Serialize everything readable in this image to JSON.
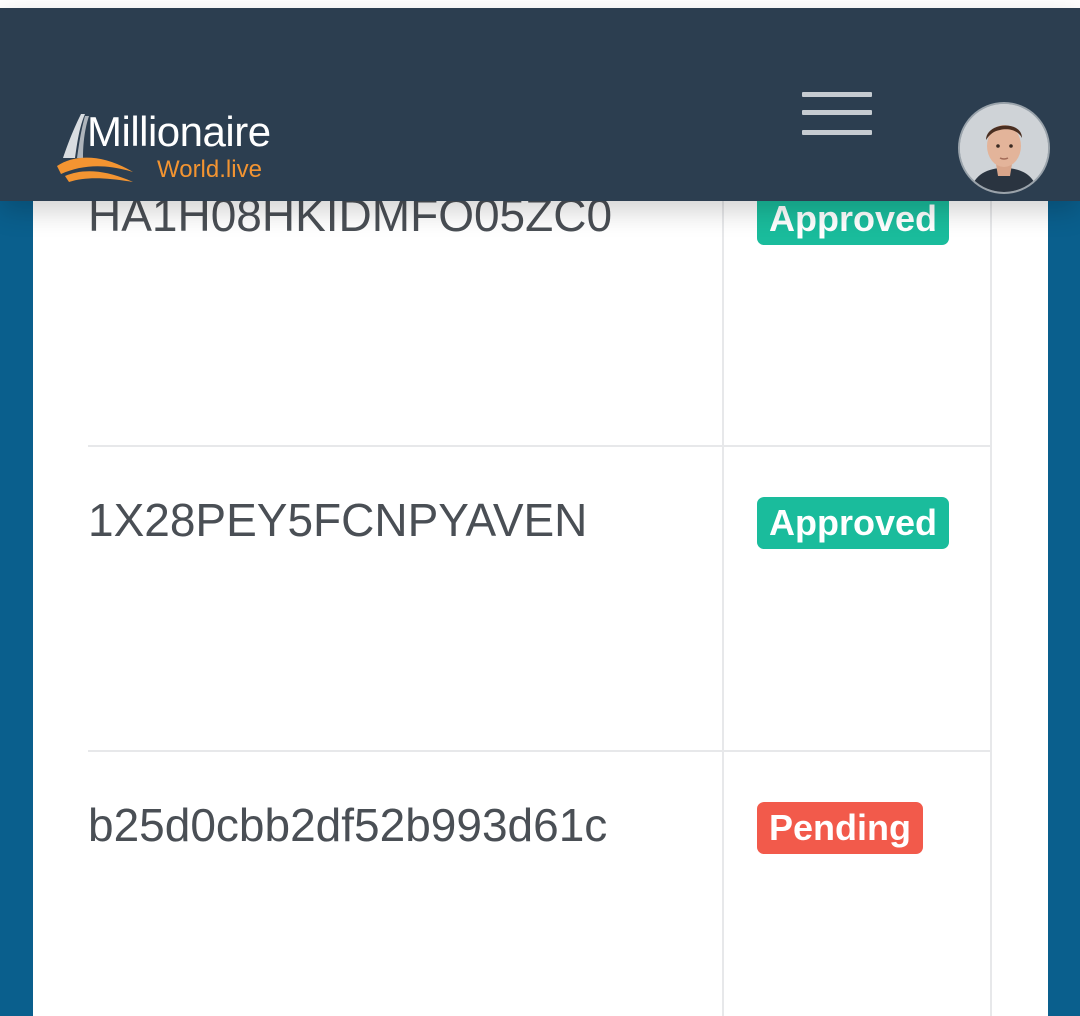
{
  "brand": {
    "name": "Millionaire",
    "subtitle": "World.live",
    "accent_color": "#f39431",
    "header_color": "#2c3e50"
  },
  "header": {
    "menu_icon": "hamburger-menu-icon",
    "avatar_icon": "user-avatar"
  },
  "transactions": [
    {
      "hash": "HA1H08HKIDMFO05ZC0",
      "status": "Approved",
      "status_color": "#1abc9c"
    },
    {
      "hash": "1X28PEY5FCNPYAVEN",
      "status": "Approved",
      "status_color": "#1abc9c"
    },
    {
      "hash": "b25d0cbb2df52b993d61c",
      "status": "Pending",
      "status_color": "#f25a4b"
    }
  ],
  "colors": {
    "page_background": "#0a5f8d",
    "approved": "#1abc9c",
    "pending": "#f25a4b"
  }
}
